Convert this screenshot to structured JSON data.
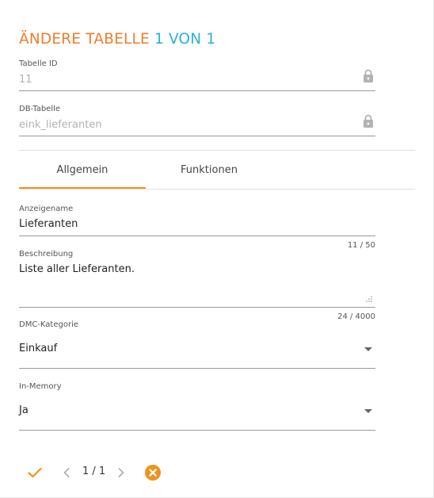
{
  "header": {
    "title_main": "ÄNDERE TABELLE",
    "title_count": "1 VON 1"
  },
  "fields": {
    "tabelle_id": {
      "label": "Tabelle ID",
      "value": "11"
    },
    "db_tabelle": {
      "label": "DB-Tabelle",
      "value": "eink_lieferanten"
    }
  },
  "tabs": [
    {
      "label": "Allgemein",
      "active": true
    },
    {
      "label": "Funktionen",
      "active": false
    }
  ],
  "general": {
    "anzeigename": {
      "label": "Anzeigename",
      "value": "Lieferanten",
      "counter": "11 / 50"
    },
    "beschreibung": {
      "label": "Beschreibung",
      "value": "Liste aller Lieferanten.",
      "counter": "24 / 4000"
    },
    "dmc_kategorie": {
      "label": "DMC-Kategorie",
      "value": "Einkauf"
    },
    "in_memory": {
      "label": "In-Memory",
      "value": "Ja"
    }
  },
  "footer": {
    "pager": "1 / 1"
  },
  "colors": {
    "accent_orange": "#f07d2c",
    "accent_blue": "#2ab0d6",
    "tab_indicator": "#f0931c"
  },
  "icons": [
    "lock-icon",
    "checkmark-icon",
    "chevron-left-icon",
    "chevron-right-icon",
    "close-circle-icon",
    "resize-grip-icon",
    "dropdown-arrow-icon"
  ]
}
